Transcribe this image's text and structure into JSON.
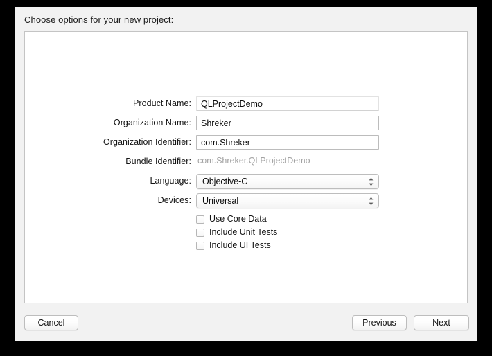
{
  "window": {
    "title": "Choose options for your new project:"
  },
  "form": {
    "fields": [
      {
        "label": "Product Name:",
        "value": "QLProjectDemo",
        "type": "text",
        "focused": true
      },
      {
        "label": "Organization Name:",
        "value": "Shreker",
        "type": "text",
        "focused": false
      },
      {
        "label": "Organization Identifier:",
        "value": "com.Shreker",
        "type": "text",
        "focused": false
      },
      {
        "label": "Bundle Identifier:",
        "value": "com.Shreker.QLProjectDemo",
        "type": "readonly",
        "focused": false
      },
      {
        "label": "Language:",
        "value": "Objective-C",
        "type": "popup",
        "focused": false
      },
      {
        "label": "Devices:",
        "value": "Universal",
        "type": "popup",
        "focused": false
      }
    ],
    "checkboxes": [
      {
        "label": "Use Core Data",
        "checked": false
      },
      {
        "label": "Include Unit Tests",
        "checked": false
      },
      {
        "label": "Include UI Tests",
        "checked": false
      }
    ]
  },
  "buttons": {
    "cancel": "Cancel",
    "previous": "Previous",
    "next": "Next"
  },
  "icons": {
    "stepper": "up-down-chevron-icon"
  },
  "colors": {
    "desktop": "#000000",
    "window_chrome": "#f2f2f2",
    "panel": "#ffffff",
    "text": "#141414",
    "readonly_text": "#a2a2a2",
    "border": "#bdbdbd"
  }
}
